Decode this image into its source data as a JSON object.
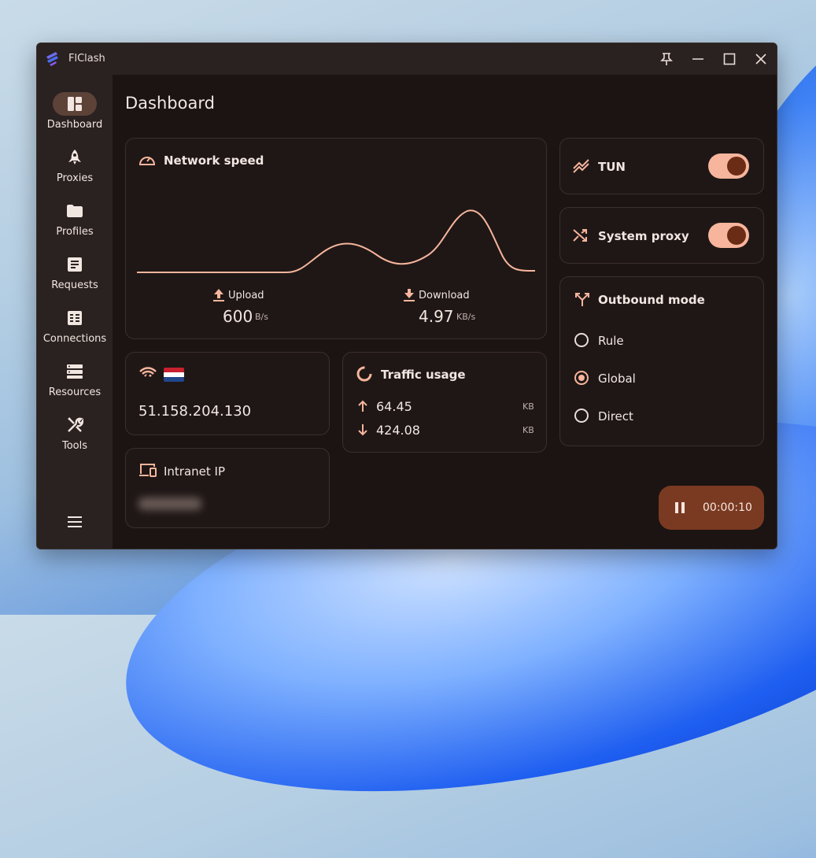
{
  "window": {
    "app_title": "FlClash"
  },
  "sidebar": {
    "items": [
      {
        "label": "Dashboard",
        "icon": "dashboard-icon",
        "active": true
      },
      {
        "label": "Proxies",
        "icon": "rocket-icon"
      },
      {
        "label": "Profiles",
        "icon": "folder-icon"
      },
      {
        "label": "Requests",
        "icon": "requests-icon"
      },
      {
        "label": "Connections",
        "icon": "connections-icon"
      },
      {
        "label": "Resources",
        "icon": "storage-icon"
      },
      {
        "label": "Tools",
        "icon": "tools-icon"
      }
    ]
  },
  "main": {
    "title": "Dashboard"
  },
  "network_speed": {
    "title": "Network speed",
    "upload_label": "Upload",
    "upload_value": "600",
    "upload_unit": "B/s",
    "download_label": "Download",
    "download_value": "4.97",
    "download_unit": "KB/s"
  },
  "tun": {
    "label": "TUN",
    "enabled": true
  },
  "system_proxy": {
    "label": "System proxy",
    "enabled": true
  },
  "outbound": {
    "title": "Outbound mode",
    "options": [
      "Rule",
      "Global",
      "Direct"
    ],
    "selected": "Global"
  },
  "ip_card": {
    "ip": "51.158.204.130"
  },
  "traffic": {
    "title": "Traffic usage",
    "up_value": "64.45",
    "up_unit": "KB",
    "down_value": "424.08",
    "down_unit": "KB"
  },
  "intranet": {
    "title": "Intranet IP"
  },
  "timer": {
    "time": "00:00:10"
  },
  "colors": {
    "accent": "#f6b59c",
    "background": "#1b1413",
    "sidebar": "#2a2220",
    "fab": "#7a3a22"
  }
}
